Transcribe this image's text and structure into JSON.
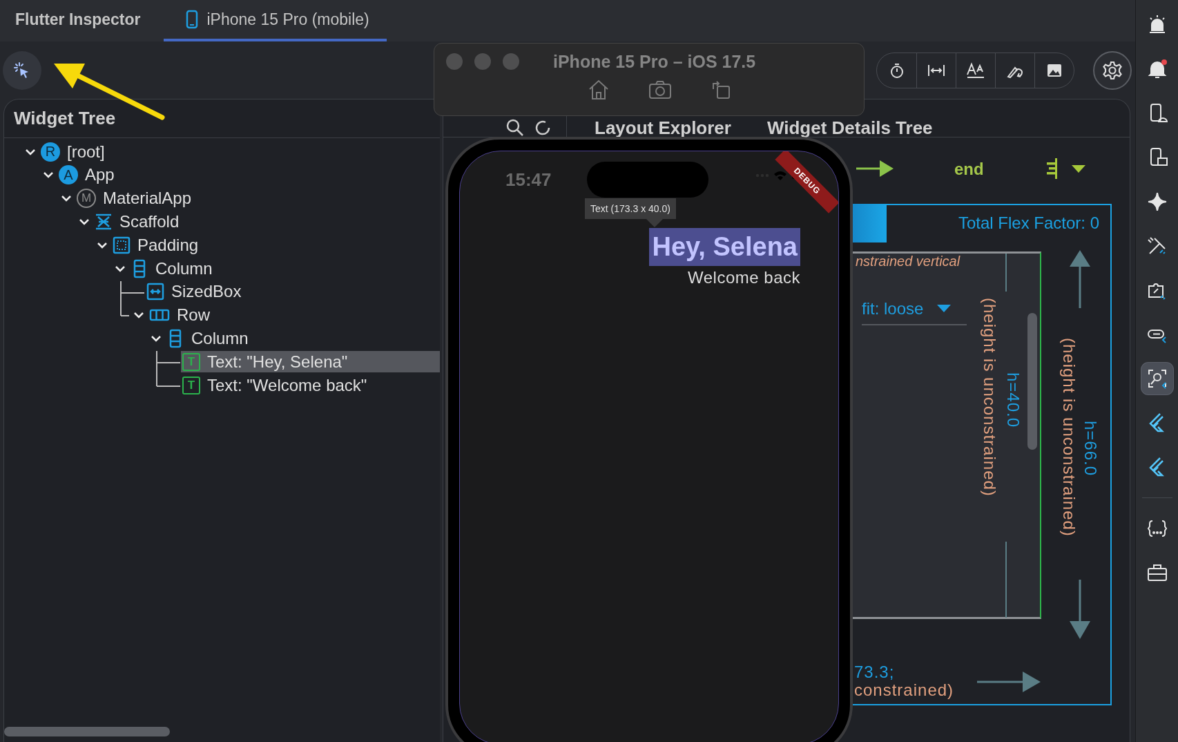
{
  "tabs": [
    {
      "label": "Flutter Inspector",
      "selected": false,
      "kind": "plain"
    },
    {
      "label": "iPhone 15 Pro (mobile)",
      "selected": true,
      "kind": "device"
    }
  ],
  "toolbar": [
    {
      "kind": "timer"
    },
    {
      "kind": "width"
    },
    {
      "kind": "text-size"
    },
    {
      "kind": "repaint"
    },
    {
      "kind": "image"
    }
  ],
  "widget_tree": {
    "title": "Widget Tree",
    "nodes": [
      {
        "label": "[root]",
        "badge": "R",
        "kind": "circle",
        "selected": false,
        "expanded": true,
        "children": [
          {
            "label": "App",
            "badge": "A",
            "kind": "circle",
            "selected": false,
            "expanded": true,
            "children": [
              {
                "label": "MaterialApp",
                "badge": "M",
                "kind": "ring",
                "selected": false,
                "expanded": true,
                "children": [
                  {
                    "label": "Scaffold",
                    "kind": "scaffold",
                    "selected": false,
                    "expanded": true,
                    "children": [
                      {
                        "label": "Padding",
                        "kind": "padding",
                        "selected": false,
                        "expanded": true,
                        "children": [
                          {
                            "label": "Column",
                            "kind": "column",
                            "selected": false,
                            "expanded": true,
                            "children": [
                              {
                                "label": "SizedBox",
                                "kind": "sizedbox",
                                "selected": false
                              },
                              {
                                "label": "Row",
                                "kind": "row",
                                "selected": false,
                                "expanded": true,
                                "children": [
                                  {
                                    "label": "Column",
                                    "kind": "column",
                                    "selected": false,
                                    "expanded": true,
                                    "children": [
                                      {
                                        "label": "Text: \"Hey, Selena\"",
                                        "badge": "T",
                                        "kind": "square",
                                        "selected": true
                                      },
                                      {
                                        "label": "Text: \"Welcome back\"",
                                        "badge": "T",
                                        "kind": "square",
                                        "selected": false
                                      }
                                    ]
                                  }
                                ]
                              }
                            ]
                          }
                        ]
                      }
                    ]
                  }
                ]
              }
            ]
          }
        ]
      }
    ]
  },
  "details_tabs": [
    {
      "label": "Layout Explorer"
    },
    {
      "label": "Widget Details Tree"
    }
  ],
  "layout_explorer": {
    "main_axis_alignment": "end",
    "total_flex_factor": "Total Flex Factor: 0",
    "constraint_note": "nstrained vertical",
    "fit": "fit: loose",
    "child_height_note": "(height is unconstrained)",
    "child_height": "h=40.0",
    "parent_height_note": "(height is unconstrained)",
    "parent_height": "h=66.0",
    "width_value": "73.3;",
    "width_note": "constrained)"
  },
  "simulator": {
    "title": "iPhone 15 Pro – iOS 17.5"
  },
  "phone": {
    "time": "15:47",
    "banner": "DEBUG",
    "tooltip": "Text (173.3 x 40.0)",
    "greeting": "Hey, Selena",
    "subtitle": "Welcome back"
  },
  "side_toolbar": {
    "top": [
      {
        "kind": "alarm",
        "selected": false
      },
      {
        "kind": "bell",
        "selected": false
      },
      {
        "kind": "device-mobile",
        "selected": false
      },
      {
        "kind": "device-desktop",
        "selected": false
      },
      {
        "kind": "sparkle",
        "selected": false
      },
      {
        "kind": "tools",
        "selected": false
      },
      {
        "kind": "extension",
        "selected": false
      },
      {
        "kind": "link",
        "selected": false
      },
      {
        "kind": "inspector",
        "selected": true
      },
      {
        "kind": "flutter",
        "selected": false
      },
      {
        "kind": "flutter",
        "selected": false
      }
    ],
    "bottom": [
      {
        "kind": "json",
        "selected": false
      },
      {
        "kind": "toolbox",
        "selected": false
      }
    ]
  }
}
